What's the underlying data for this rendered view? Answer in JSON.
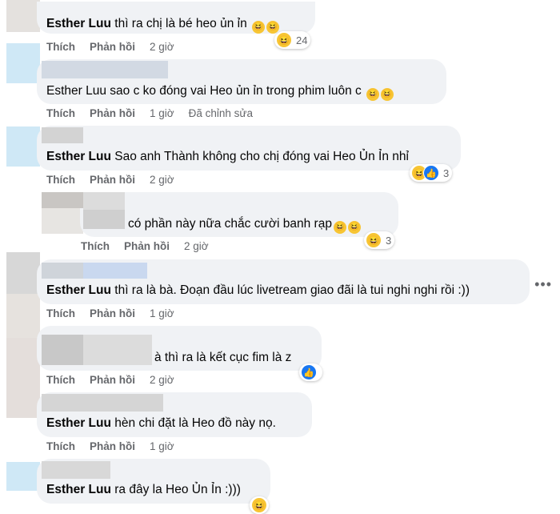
{
  "actions": {
    "like": "Thích",
    "reply": "Phản hồi"
  },
  "comments": [
    {
      "name": "Esther Luu",
      "text": "thì ra chị là bé heo ủn ỉn",
      "time": "2 giờ",
      "reaction_count": "24",
      "edited": ""
    },
    {
      "name": "Esther Luu",
      "text": "sao c ko đóng vai Heo ủn ỉn trong phim luôn c",
      "time": "1 giờ",
      "reaction_count": "",
      "edited": "Đã chỉnh sửa"
    },
    {
      "name": "Esther Luu",
      "text": "Sao anh Thành không cho chị đóng vai Heo Ủn Ỉn nhỉ",
      "time": "2 giờ",
      "reaction_count": "3",
      "edited": ""
    },
    {
      "name": "",
      "text": "có phần này nữa chắc cười banh rạp",
      "time": "2 giờ",
      "reaction_count": "3",
      "edited": ""
    },
    {
      "name": "Esther Luu",
      "text": "thì ra là bà. Đoạn đầu lúc livetream giao đãi là tui nghi nghi rồi :))",
      "time": "1 giờ",
      "reaction_count": "",
      "edited": ""
    },
    {
      "name": "",
      "text": "à thì ra là kết cục fim là z",
      "time": "2 giờ",
      "reaction_count": "",
      "edited": ""
    },
    {
      "name": "Esther Luu",
      "text": "hèn chi đặt là Heo đồ này nọ.",
      "time": "1 giờ",
      "reaction_count": "",
      "edited": ""
    },
    {
      "name": "Esther Luu",
      "text": "ra đây la Heo Ủn Ỉn :)))",
      "time": "",
      "reaction_count": "",
      "edited": ""
    }
  ],
  "icons": {
    "haha": "haha-emoji-icon",
    "like": "like-reaction-icon",
    "more": "more-options-icon"
  },
  "colors": {
    "bubble": "#f0f2f5",
    "meta": "#65676b",
    "like_blue": "#1877f2",
    "haha_yellow": "#f7c534"
  }
}
